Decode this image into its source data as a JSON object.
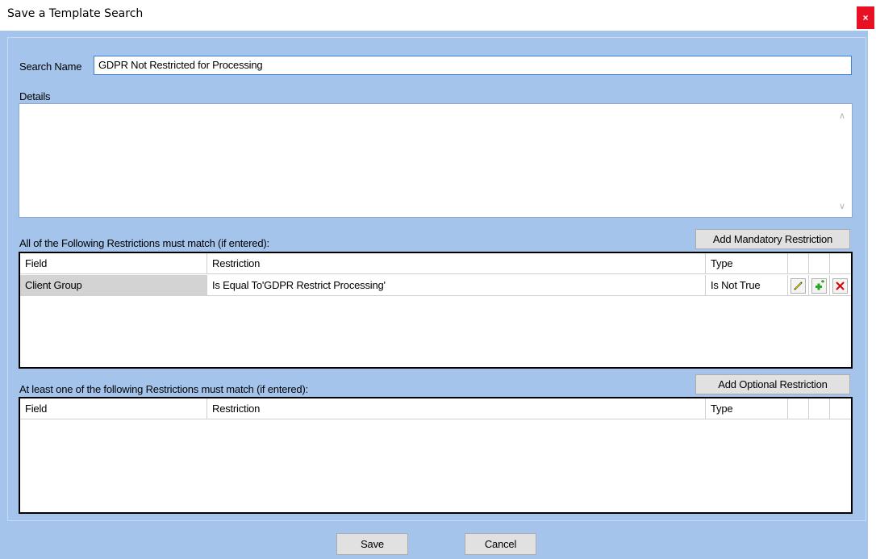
{
  "window": {
    "title": "Save a Template Search",
    "close_glyph": "×"
  },
  "search_name": {
    "label": "Search Name",
    "value": "GDPR Not Restricted for Processing"
  },
  "details": {
    "label": "Details",
    "value": "",
    "scroll_up": "∧",
    "scroll_down": "∨"
  },
  "mandatory": {
    "heading": "All of the Following Restrictions must match (if entered):",
    "add_button": "Add Mandatory Restriction",
    "columns": [
      "Field",
      "Restriction",
      "Type"
    ],
    "rows": [
      {
        "field": "Client Group",
        "restriction": "Is Equal To'GDPR Restrict Processing'",
        "type": "Is Not True",
        "edit_icon": "pencil-icon",
        "add_icon": "plus-icon",
        "delete_icon": "delete-x-icon"
      }
    ]
  },
  "optional": {
    "heading": "At least one of the following Restrictions must match (if entered):",
    "add_button": "Add Optional Restriction",
    "columns": [
      "Field",
      "Restriction",
      "Type"
    ],
    "rows": []
  },
  "footer": {
    "save_label": "Save",
    "cancel_label": "Cancel"
  },
  "colors": {
    "dialog_background": "#a5c4ec",
    "close_button": "#e81123",
    "input_border": "#3c7fd6",
    "selected_field_cell": "#d3d3d3",
    "plus_icon": "#22a822",
    "delete_icon": "#e00000"
  }
}
